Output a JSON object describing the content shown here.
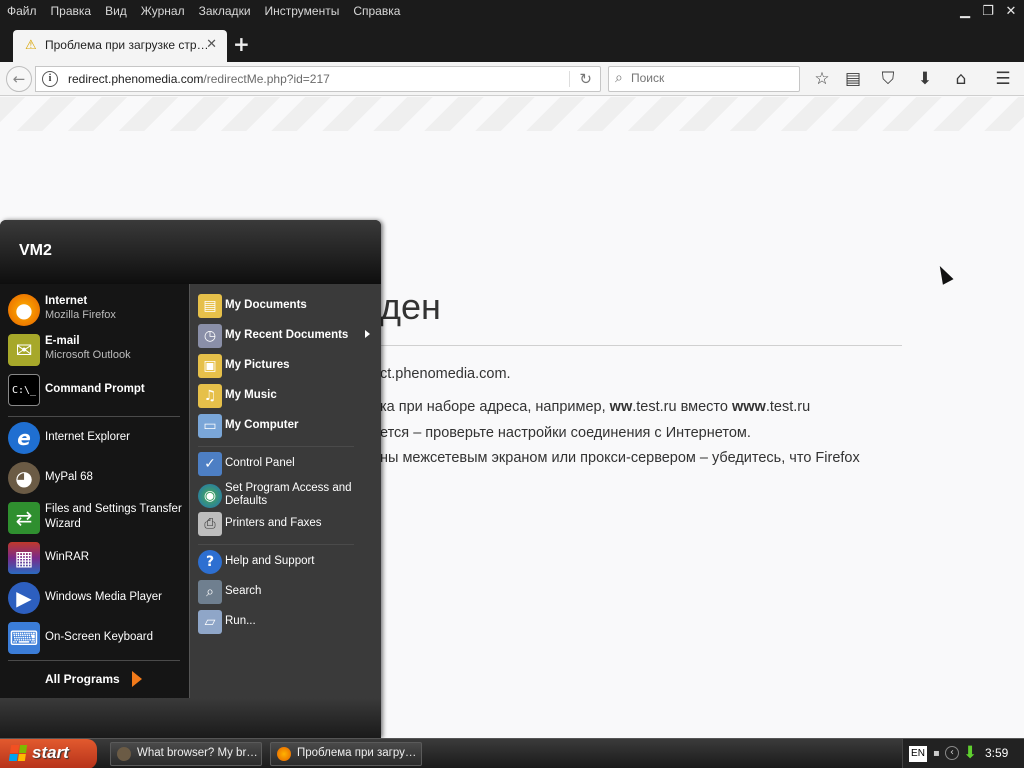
{
  "menubar": {
    "items": [
      "Файл",
      "Правка",
      "Вид",
      "Журнал",
      "Закладки",
      "Инструменты",
      "Справка"
    ]
  },
  "window_controls": {
    "minimize": "▁",
    "restore": "❐",
    "close": "✕"
  },
  "tab": {
    "title": "Проблема при загрузке стр…",
    "icon": "warning-icon",
    "close": "✕",
    "new_tab": "+"
  },
  "navbar": {
    "back_icon": "back-arrow-icon",
    "url_host": "redirect.phenomedia.com",
    "url_path": "/redirectMe.php?id=217",
    "search_placeholder": "Поиск"
  },
  "toolbar_icons": [
    "star-bookmark-icon",
    "reading-list-icon",
    "pocket-icon",
    "download-icon",
    "home-icon",
    "hamburger-menu-icon"
  ],
  "page": {
    "title_fragment": "ден",
    "line1": "ct.phenomedia.com.",
    "line2_a": "ка при наборе адреса, например,",
    "line2_b": "ww",
    "line2_c": ".test.ru вместо",
    "line2_d": "www",
    "line2_e": ".test.ru",
    "line3": "ется – проверьте настройки соединения с Интернетом.",
    "line4": "ны межсетевым экраном или прокси-сервером – убедитесь, что Firefox"
  },
  "start_menu": {
    "user": "VM2",
    "pinned": [
      {
        "label": "Internet",
        "sub": "Mozilla Firefox",
        "icon": "firefox-icon",
        "color": "#e66000"
      },
      {
        "label": "E-mail",
        "sub": "Microsoft Outlook",
        "icon": "outlook-icon",
        "color": "#a7a82a"
      }
    ],
    "command_prompt": "Command Prompt",
    "recent": [
      {
        "label": "Internet Explorer",
        "icon": "internet-explorer-icon",
        "color": "#1f6fd1"
      },
      {
        "label": "MyPal 68",
        "icon": "mypal-raccoon-icon",
        "color": "#6b5b45"
      },
      {
        "label": "Files and Settings Transfer",
        "label2": "Wizard",
        "icon": "transfer-wizard-icon",
        "color": "#2f8f2f"
      },
      {
        "label": "WinRAR",
        "icon": "winrar-icon",
        "color": "#7a2a8a"
      },
      {
        "label": "Windows Media Player",
        "icon": "media-player-icon",
        "color": "#2d5fbf"
      },
      {
        "label": "On-Screen Keyboard",
        "icon": "keyboard-icon",
        "color": "#3b7dd8"
      }
    ],
    "all_programs": "All Programs",
    "places": [
      {
        "label": "My Documents",
        "icon": "my-documents-icon"
      },
      {
        "label": "My Recent Documents",
        "icon": "recent-documents-icon"
      },
      {
        "label": "My Pictures",
        "icon": "my-pictures-icon"
      },
      {
        "label": "My Music",
        "icon": "my-music-icon"
      },
      {
        "label": "My Computer",
        "icon": "my-computer-icon"
      }
    ],
    "settings": [
      {
        "label": "Control Panel",
        "icon": "control-panel-icon"
      },
      {
        "label": "Set Program Access and Defaults",
        "icon": "program-defaults-icon"
      },
      {
        "label": "Printers and Faxes",
        "icon": "printer-icon"
      }
    ],
    "help": [
      {
        "label": "Help and Support",
        "icon": "help-icon"
      },
      {
        "label": "Search",
        "icon": "search-icon"
      },
      {
        "label": "Run...",
        "icon": "run-icon"
      }
    ]
  },
  "taskbar": {
    "start": "start",
    "tasks": [
      {
        "label": "What browser? My br…",
        "icon": "mypal-raccoon-icon"
      },
      {
        "label": "Проблема при загру…",
        "icon": "firefox-icon"
      }
    ],
    "tray": {
      "lang": "EN",
      "time": "3:59"
    }
  },
  "colors": {
    "taskbar_start": "#c8401f",
    "accent_orange": "#f27a1a",
    "menu_left_bg": "#151515",
    "menu_right_bg": "#3a3a3a"
  }
}
